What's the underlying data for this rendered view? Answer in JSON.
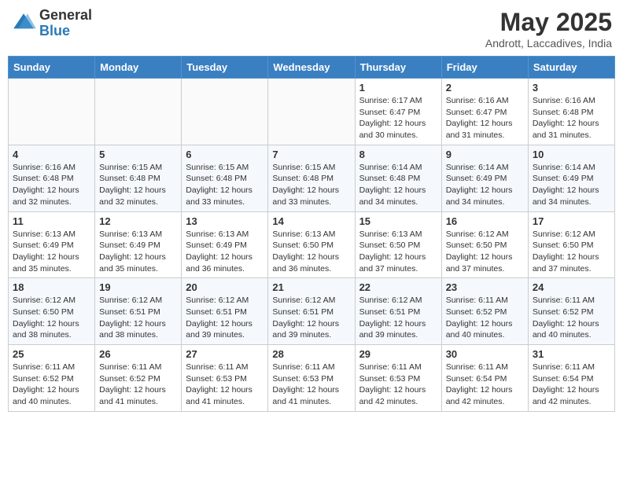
{
  "logo": {
    "general": "General",
    "blue": "Blue"
  },
  "title": "May 2025",
  "subtitle": "Andrott, Laccadives, India",
  "days_of_week": [
    "Sunday",
    "Monday",
    "Tuesday",
    "Wednesday",
    "Thursday",
    "Friday",
    "Saturday"
  ],
  "weeks": [
    [
      {
        "day": "",
        "info": ""
      },
      {
        "day": "",
        "info": ""
      },
      {
        "day": "",
        "info": ""
      },
      {
        "day": "",
        "info": ""
      },
      {
        "day": "1",
        "info": "Sunrise: 6:17 AM\nSunset: 6:47 PM\nDaylight: 12 hours and 30 minutes."
      },
      {
        "day": "2",
        "info": "Sunrise: 6:16 AM\nSunset: 6:47 PM\nDaylight: 12 hours and 31 minutes."
      },
      {
        "day": "3",
        "info": "Sunrise: 6:16 AM\nSunset: 6:48 PM\nDaylight: 12 hours and 31 minutes."
      }
    ],
    [
      {
        "day": "4",
        "info": "Sunrise: 6:16 AM\nSunset: 6:48 PM\nDaylight: 12 hours and 32 minutes."
      },
      {
        "day": "5",
        "info": "Sunrise: 6:15 AM\nSunset: 6:48 PM\nDaylight: 12 hours and 32 minutes."
      },
      {
        "day": "6",
        "info": "Sunrise: 6:15 AM\nSunset: 6:48 PM\nDaylight: 12 hours and 33 minutes."
      },
      {
        "day": "7",
        "info": "Sunrise: 6:15 AM\nSunset: 6:48 PM\nDaylight: 12 hours and 33 minutes."
      },
      {
        "day": "8",
        "info": "Sunrise: 6:14 AM\nSunset: 6:48 PM\nDaylight: 12 hours and 34 minutes."
      },
      {
        "day": "9",
        "info": "Sunrise: 6:14 AM\nSunset: 6:49 PM\nDaylight: 12 hours and 34 minutes."
      },
      {
        "day": "10",
        "info": "Sunrise: 6:14 AM\nSunset: 6:49 PM\nDaylight: 12 hours and 34 minutes."
      }
    ],
    [
      {
        "day": "11",
        "info": "Sunrise: 6:13 AM\nSunset: 6:49 PM\nDaylight: 12 hours and 35 minutes."
      },
      {
        "day": "12",
        "info": "Sunrise: 6:13 AM\nSunset: 6:49 PM\nDaylight: 12 hours and 35 minutes."
      },
      {
        "day": "13",
        "info": "Sunrise: 6:13 AM\nSunset: 6:49 PM\nDaylight: 12 hours and 36 minutes."
      },
      {
        "day": "14",
        "info": "Sunrise: 6:13 AM\nSunset: 6:50 PM\nDaylight: 12 hours and 36 minutes."
      },
      {
        "day": "15",
        "info": "Sunrise: 6:13 AM\nSunset: 6:50 PM\nDaylight: 12 hours and 37 minutes."
      },
      {
        "day": "16",
        "info": "Sunrise: 6:12 AM\nSunset: 6:50 PM\nDaylight: 12 hours and 37 minutes."
      },
      {
        "day": "17",
        "info": "Sunrise: 6:12 AM\nSunset: 6:50 PM\nDaylight: 12 hours and 37 minutes."
      }
    ],
    [
      {
        "day": "18",
        "info": "Sunrise: 6:12 AM\nSunset: 6:50 PM\nDaylight: 12 hours and 38 minutes."
      },
      {
        "day": "19",
        "info": "Sunrise: 6:12 AM\nSunset: 6:51 PM\nDaylight: 12 hours and 38 minutes."
      },
      {
        "day": "20",
        "info": "Sunrise: 6:12 AM\nSunset: 6:51 PM\nDaylight: 12 hours and 39 minutes."
      },
      {
        "day": "21",
        "info": "Sunrise: 6:12 AM\nSunset: 6:51 PM\nDaylight: 12 hours and 39 minutes."
      },
      {
        "day": "22",
        "info": "Sunrise: 6:12 AM\nSunset: 6:51 PM\nDaylight: 12 hours and 39 minutes."
      },
      {
        "day": "23",
        "info": "Sunrise: 6:11 AM\nSunset: 6:52 PM\nDaylight: 12 hours and 40 minutes."
      },
      {
        "day": "24",
        "info": "Sunrise: 6:11 AM\nSunset: 6:52 PM\nDaylight: 12 hours and 40 minutes."
      }
    ],
    [
      {
        "day": "25",
        "info": "Sunrise: 6:11 AM\nSunset: 6:52 PM\nDaylight: 12 hours and 40 minutes."
      },
      {
        "day": "26",
        "info": "Sunrise: 6:11 AM\nSunset: 6:52 PM\nDaylight: 12 hours and 41 minutes."
      },
      {
        "day": "27",
        "info": "Sunrise: 6:11 AM\nSunset: 6:53 PM\nDaylight: 12 hours and 41 minutes."
      },
      {
        "day": "28",
        "info": "Sunrise: 6:11 AM\nSunset: 6:53 PM\nDaylight: 12 hours and 41 minutes."
      },
      {
        "day": "29",
        "info": "Sunrise: 6:11 AM\nSunset: 6:53 PM\nDaylight: 12 hours and 42 minutes."
      },
      {
        "day": "30",
        "info": "Sunrise: 6:11 AM\nSunset: 6:54 PM\nDaylight: 12 hours and 42 minutes."
      },
      {
        "day": "31",
        "info": "Sunrise: 6:11 AM\nSunset: 6:54 PM\nDaylight: 12 hours and 42 minutes."
      }
    ]
  ]
}
